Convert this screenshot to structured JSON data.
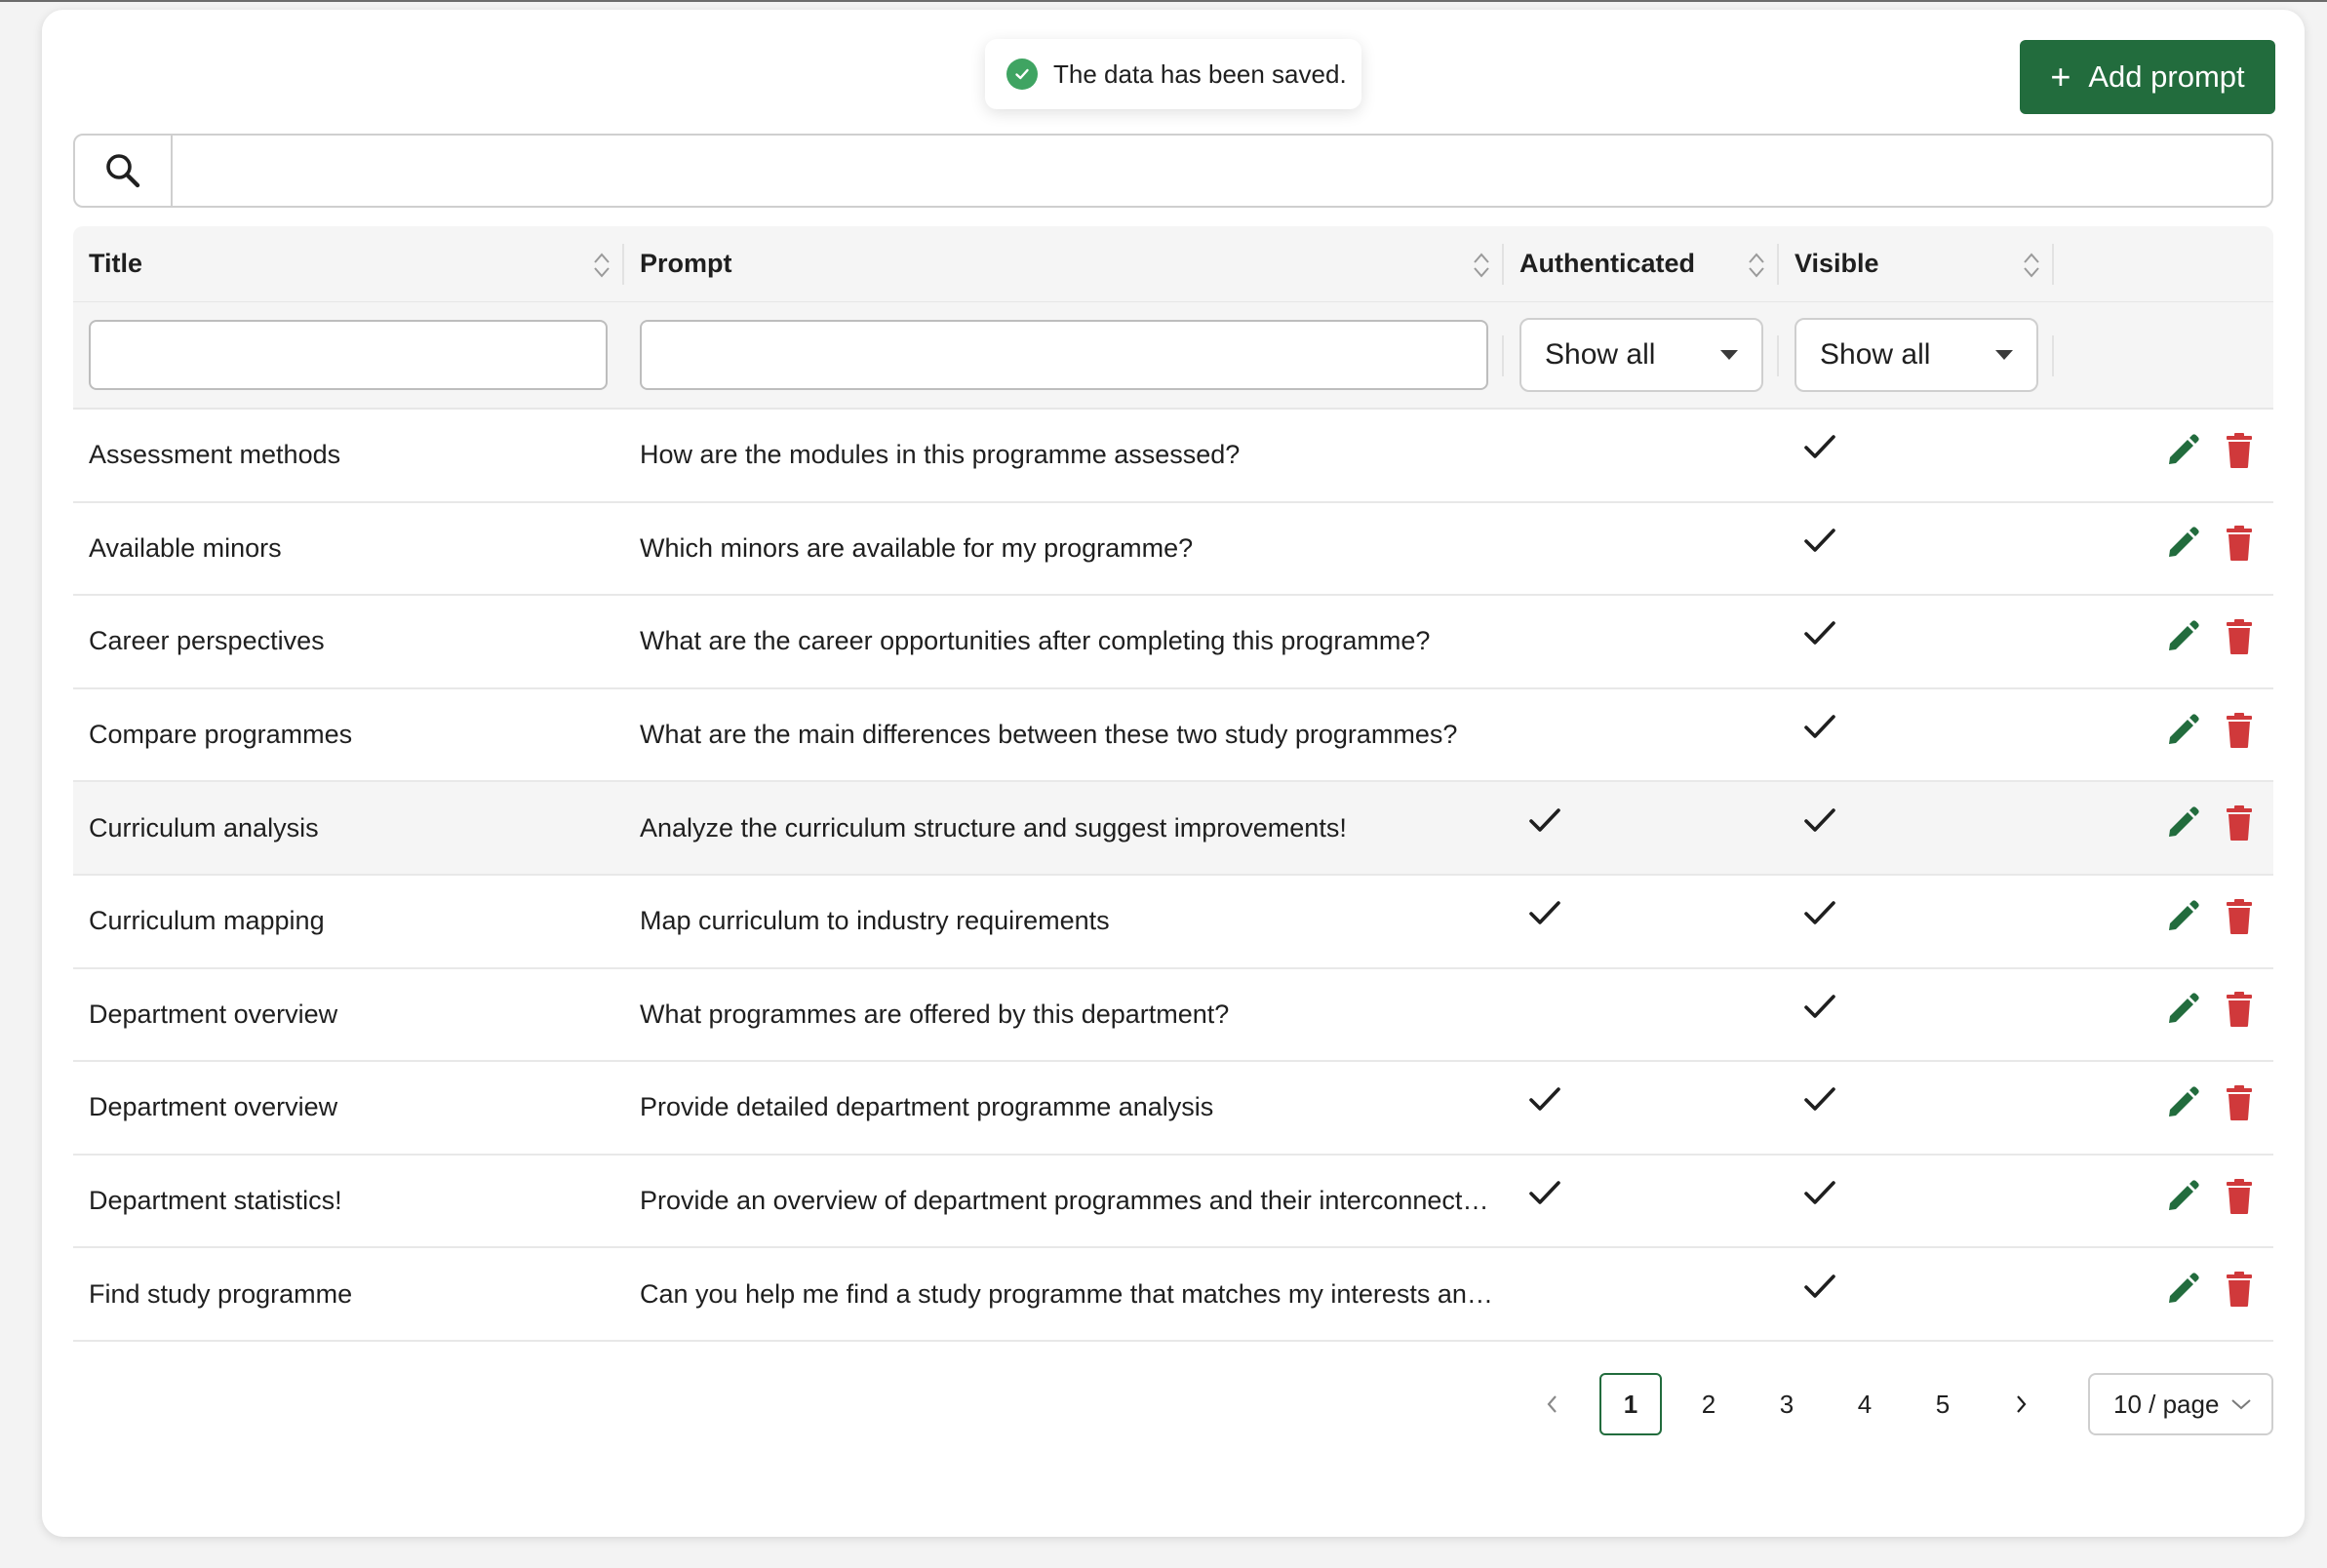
{
  "toast": {
    "message": "The data has been saved."
  },
  "toolbar": {
    "add_label": "Add prompt",
    "add_icon": "plus-icon"
  },
  "search": {
    "placeholder": "",
    "value": ""
  },
  "columns": [
    {
      "label": "Title"
    },
    {
      "label": "Prompt"
    },
    {
      "label": "Authenticated"
    },
    {
      "label": "Visible"
    }
  ],
  "filters": {
    "title": "",
    "prompt": "",
    "authenticated": "Show all",
    "visible": "Show all"
  },
  "rows": [
    {
      "title": "Assessment methods",
      "prompt": "How are the modules in this programme assessed?",
      "authenticated": false,
      "visible": true
    },
    {
      "title": "Available minors",
      "prompt": "Which minors are available for my programme?",
      "authenticated": false,
      "visible": true
    },
    {
      "title": "Career perspectives",
      "prompt": "What are the career opportunities after completing this programme?",
      "authenticated": false,
      "visible": true
    },
    {
      "title": "Compare programmes",
      "prompt": "What are the main differences between these two study programmes?",
      "authenticated": false,
      "visible": true
    },
    {
      "title": "Curriculum analysis",
      "prompt": "Analyze the curriculum structure and suggest improvements!",
      "authenticated": true,
      "visible": true
    },
    {
      "title": "Curriculum mapping",
      "prompt": "Map curriculum to industry requirements",
      "authenticated": true,
      "visible": true
    },
    {
      "title": "Department overview",
      "prompt": "What programmes are offered by this department?",
      "authenticated": false,
      "visible": true
    },
    {
      "title": "Department overview",
      "prompt": "Provide detailed department programme analysis",
      "authenticated": true,
      "visible": true
    },
    {
      "title": "Department statistics!",
      "prompt": "Provide an overview of department programmes and their interconnecti…",
      "authenticated": true,
      "visible": true
    },
    {
      "title": "Find study programme",
      "prompt": "Can you help me find a study programme that matches my interests and …",
      "authenticated": false,
      "visible": true
    }
  ],
  "pagination": {
    "pages": [
      "1",
      "2",
      "3",
      "4",
      "5"
    ],
    "current": "1",
    "page_size": "10 / page"
  },
  "colors": {
    "primary": "#226c3d",
    "delete": "#d0393b",
    "success": "#3fa462"
  }
}
